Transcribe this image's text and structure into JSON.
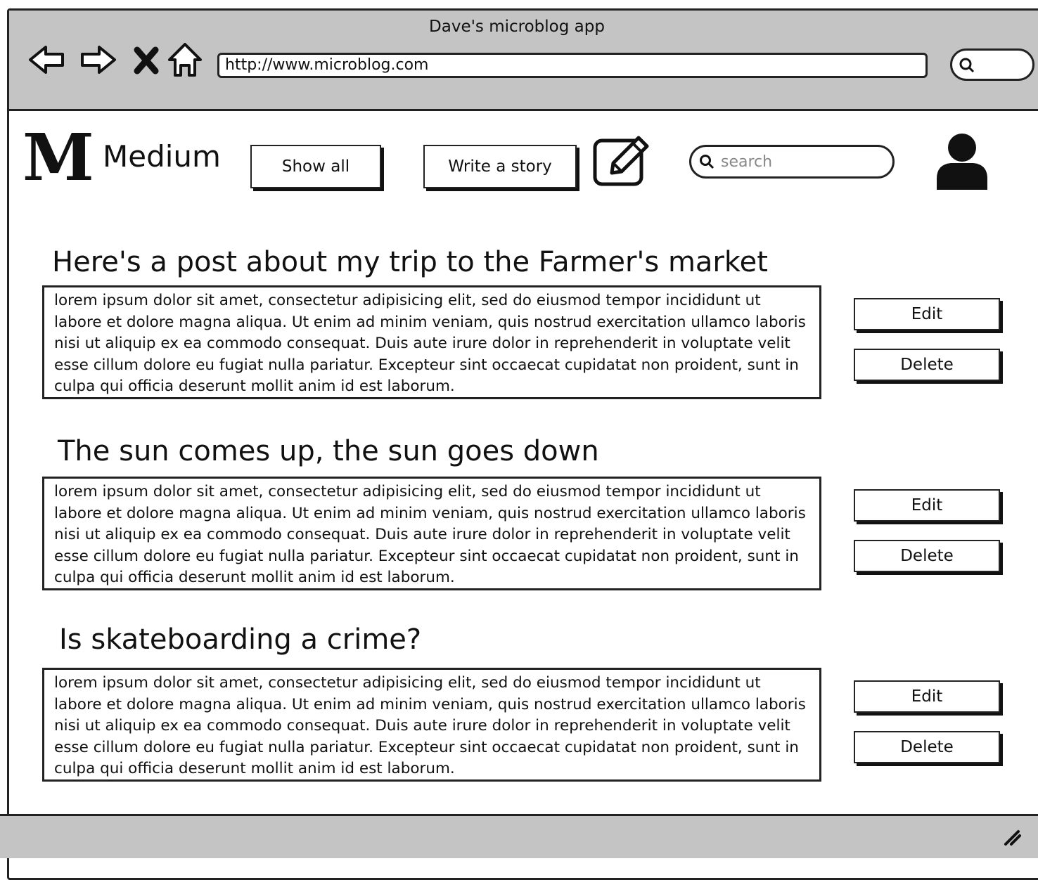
{
  "window": {
    "title": "Dave's microblog app"
  },
  "browser": {
    "url": "http://www.microblog.com",
    "nav_icons": [
      "back-arrow-icon",
      "forward-arrow-icon",
      "close-x-icon",
      "home-icon"
    ]
  },
  "header": {
    "logo_letter": "M",
    "logo_text": "Medium",
    "show_all_label": "Show all",
    "write_story_label": "Write a story",
    "search_placeholder": "search"
  },
  "posts": [
    {
      "title": "Here's a post about my trip to the Farmer's market",
      "body": "lorem ipsum dolor sit amet, consectetur adipisicing elit, sed do eiusmod tempor incididunt ut labore et dolore magna aliqua. Ut enim ad minim veniam, quis nostrud exercitation ullamco laboris nisi ut aliquip ex ea commodo consequat. Duis aute irure dolor in reprehenderit in voluptate velit esse cillum dolore eu fugiat nulla pariatur. Excepteur sint occaecat cupidatat non proident, sunt in culpa qui officia deserunt mollit anim id est laborum.",
      "edit_label": "Edit",
      "delete_label": "Delete"
    },
    {
      "title": "The sun comes up, the sun goes down",
      "body": "lorem ipsum dolor sit amet, consectetur adipisicing elit, sed do eiusmod tempor incididunt ut labore et dolore magna aliqua. Ut enim ad minim veniam, quis nostrud exercitation ullamco laboris nisi ut aliquip ex ea commodo consequat. Duis aute irure dolor in reprehenderit in voluptate velit esse cillum dolore eu fugiat nulla pariatur. Excepteur sint occaecat cupidatat non proident, sunt in culpa qui officia deserunt mollit anim id est laborum.",
      "edit_label": "Edit",
      "delete_label": "Delete"
    },
    {
      "title": "Is skateboarding a crime?",
      "body": "lorem ipsum dolor sit amet, consectetur adipisicing elit, sed do eiusmod tempor incididunt ut labore et dolore magna aliqua. Ut enim ad minim veniam, quis nostrud exercitation ullamco laboris nisi ut aliquip ex ea commodo consequat. Duis aute irure dolor in reprehenderit in voluptate velit esse cillum dolore eu fugiat nulla pariatur. Excepteur sint occaecat cupidatat non proident, sunt in culpa qui officia deserunt mollit anim id est laborum.",
      "edit_label": "Edit",
      "delete_label": "Delete"
    }
  ]
}
